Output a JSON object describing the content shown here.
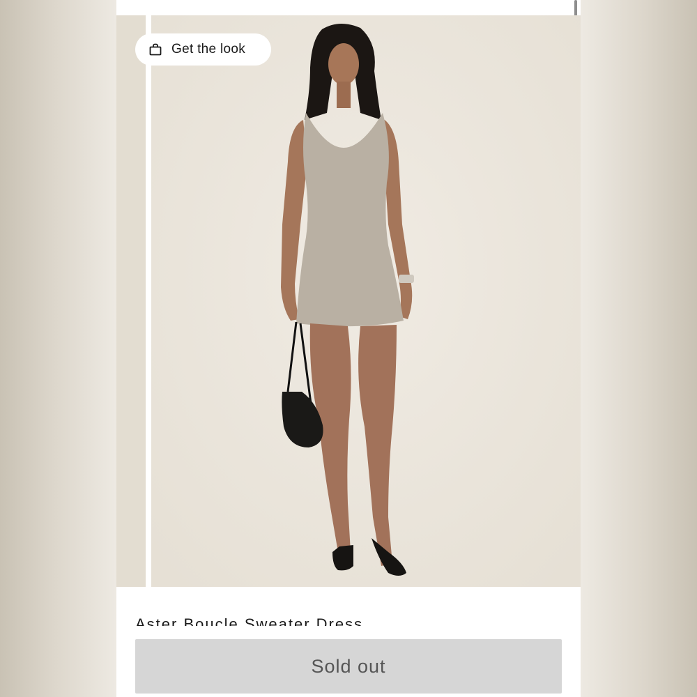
{
  "gallery": {
    "get_the_look": {
      "label": "Get the look",
      "icon": "shopping-bag-icon"
    }
  },
  "product": {
    "title": "Aster Boucle Sweater Dress"
  },
  "purchase": {
    "button_label": "Sold out"
  },
  "colors": {
    "backdrop": "#ede8df",
    "dress": "#b9b0a3",
    "button_bg": "#d6d6d6",
    "button_text": "#555555"
  }
}
